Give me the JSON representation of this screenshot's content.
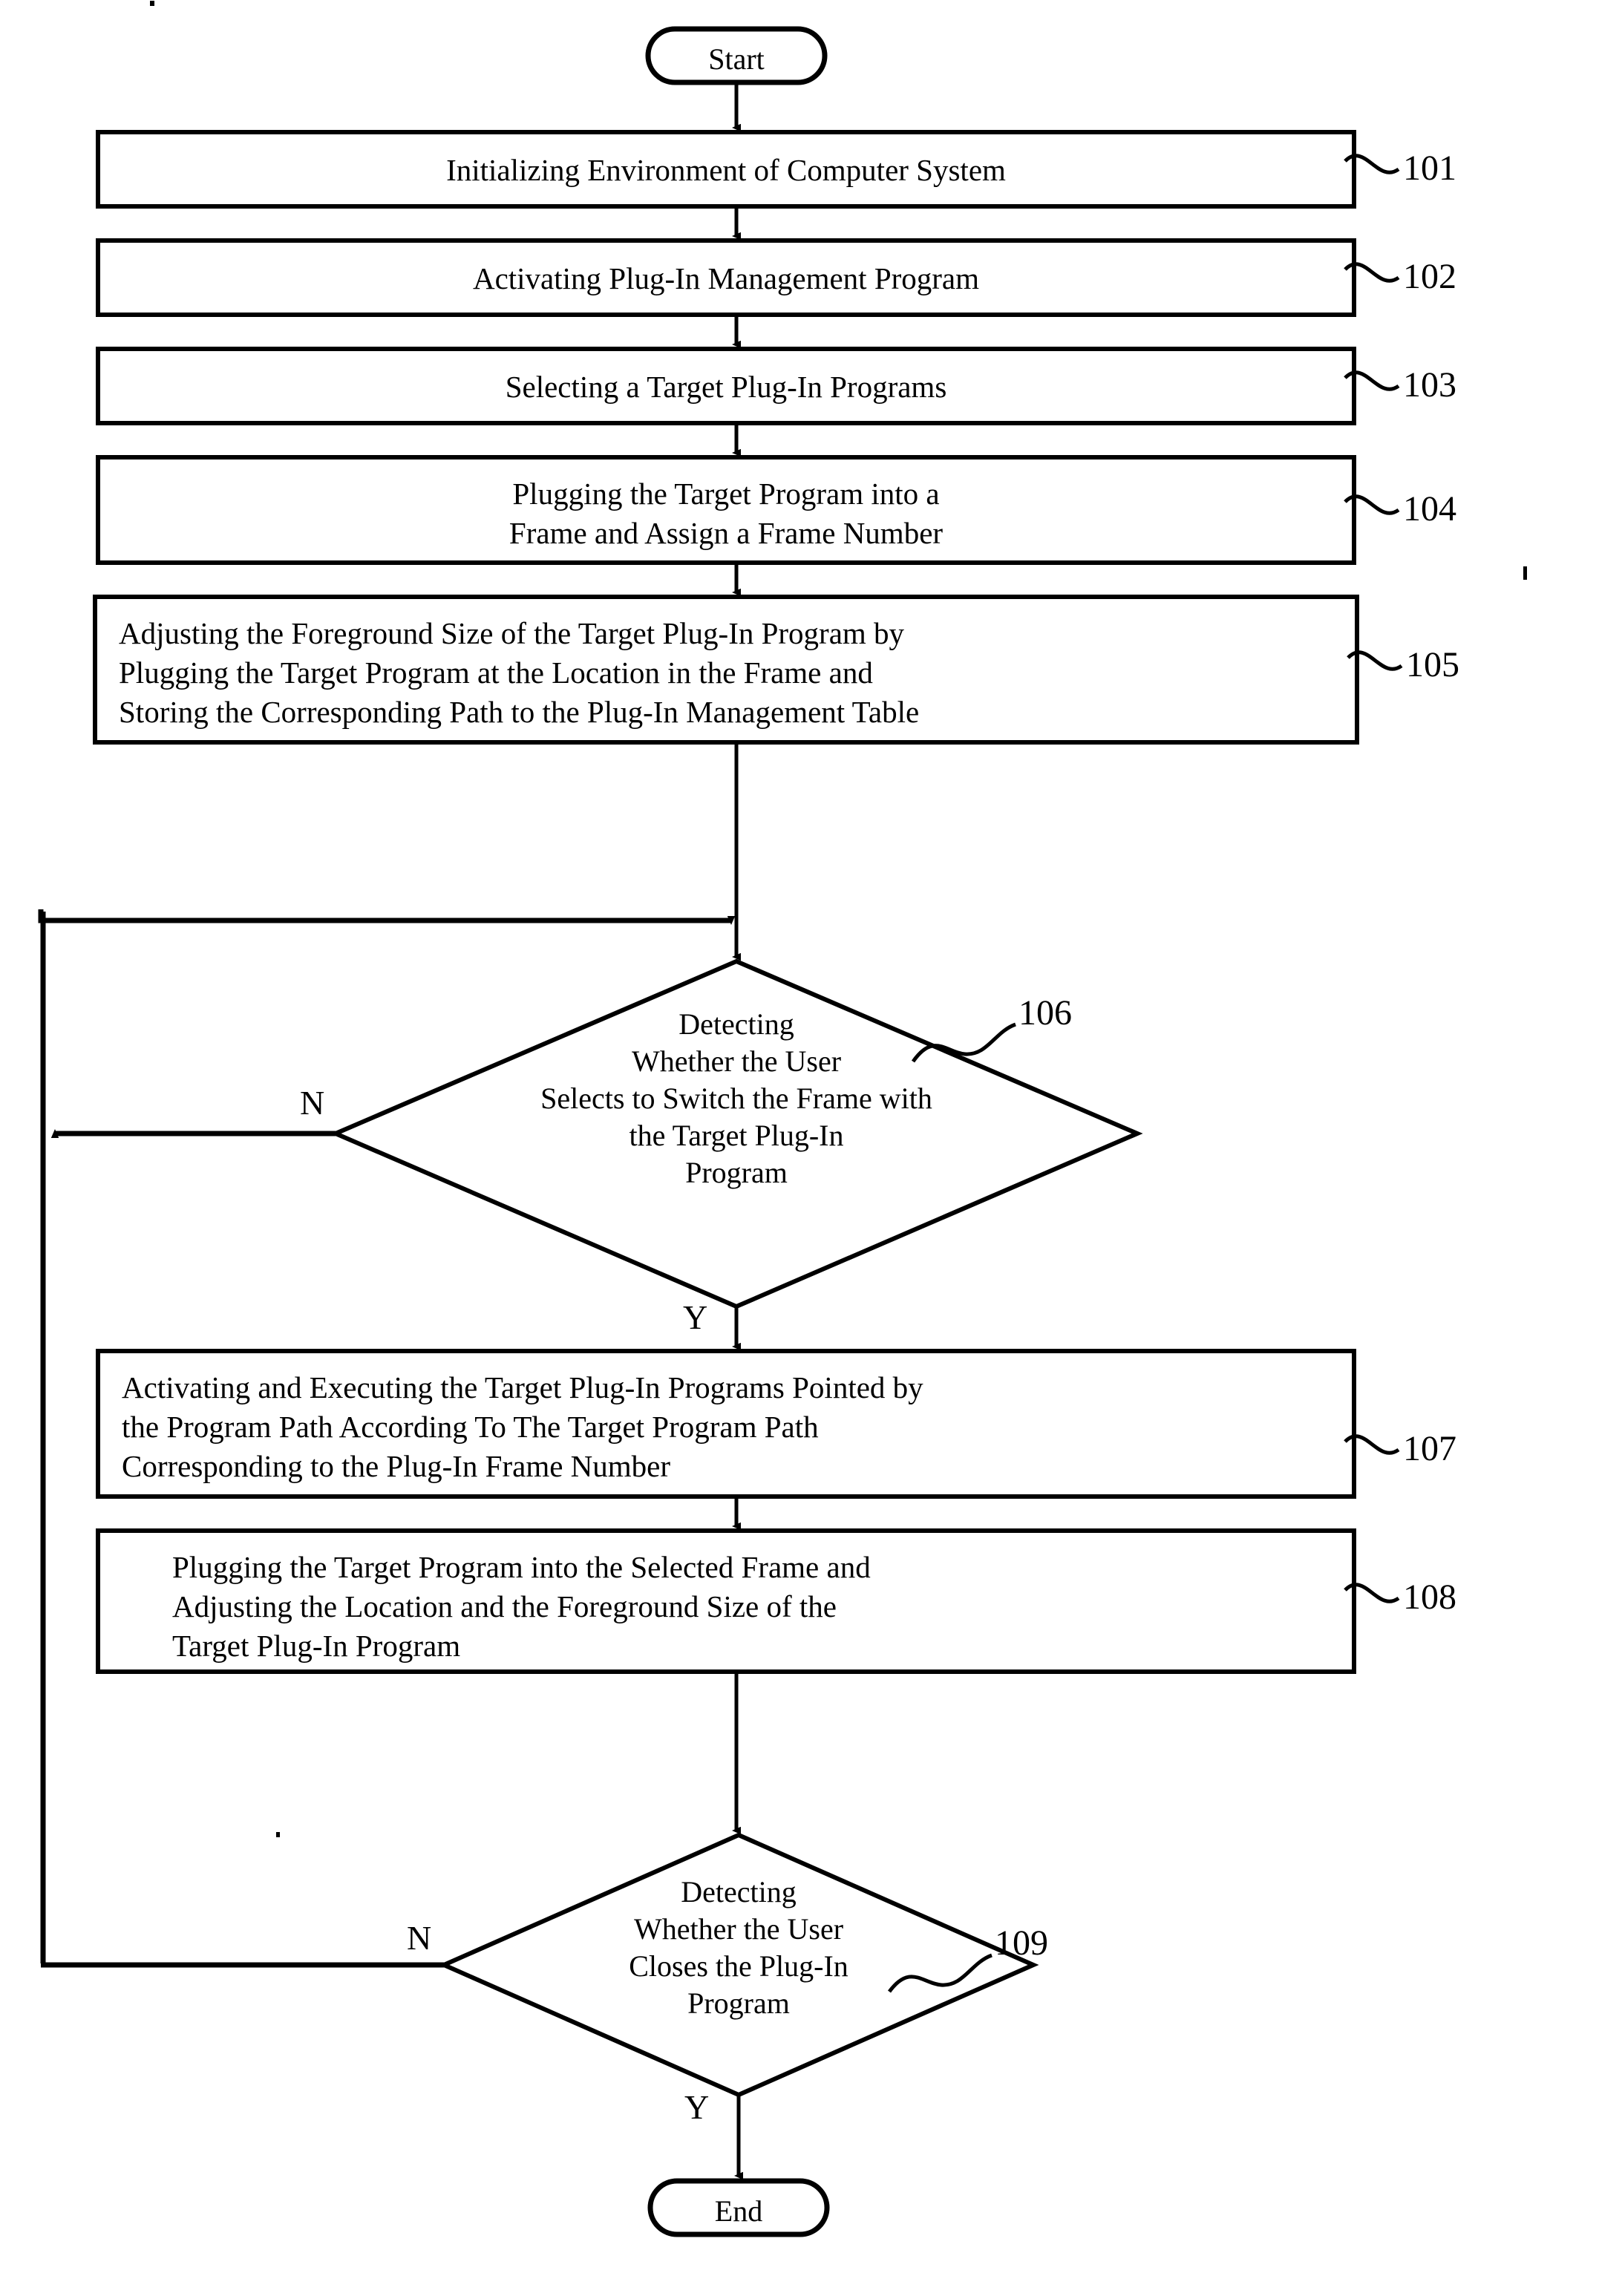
{
  "diagram": {
    "kind": "patent-flowchart",
    "background_color": "#ffffff",
    "line_color": "#000000",
    "terminators": {
      "start": "Start",
      "end": "End"
    },
    "branch_labels": {
      "no": "N",
      "yes": "Y"
    },
    "steps": [
      {
        "ref": "101",
        "shape": "process",
        "lines": [
          "Initializing Environment of Computer System"
        ]
      },
      {
        "ref": "102",
        "shape": "process",
        "lines": [
          "Activating Plug-In Management Program"
        ]
      },
      {
        "ref": "103",
        "shape": "process",
        "lines": [
          "Selecting a Target Plug-In Programs"
        ]
      },
      {
        "ref": "104",
        "shape": "process",
        "lines": [
          "Plugging the Target Program into a",
          "Frame and Assign a Frame Number"
        ]
      },
      {
        "ref": "105",
        "shape": "process",
        "lines": [
          "Adjusting the Foreground Size of the Target Plug-In Program by",
          "Plugging the Target Program at the Location in the Frame and",
          "Storing the Corresponding Path to the Plug-In Management Table"
        ]
      },
      {
        "ref": "106",
        "shape": "decision",
        "lines": [
          "Detecting",
          "Whether the User",
          "Selects to Switch the Frame with",
          "the Target Plug-In",
          "Program"
        ],
        "no_label": "N",
        "yes_label": "Y"
      },
      {
        "ref": "107",
        "shape": "process",
        "lines": [
          "Activating and Executing the Target Plug-In Programs Pointed by",
          "the Program Path According To The Target Program Path",
          "Corresponding to the Plug-In Frame Number"
        ]
      },
      {
        "ref": "108",
        "shape": "process",
        "lines": [
          "Plugging the Target Program into the Selected Frame and",
          "Adjusting the Location and the Foreground Size of the",
          "Target Plug-In Program"
        ]
      },
      {
        "ref": "109",
        "shape": "decision",
        "lines": [
          "Detecting",
          "Whether the User",
          "Closes the Plug-In",
          "Program"
        ],
        "no_label": "N",
        "yes_label": "Y"
      }
    ]
  }
}
